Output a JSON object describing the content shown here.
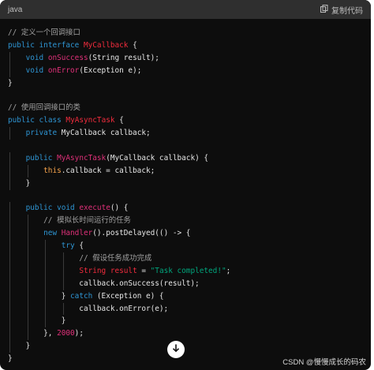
{
  "header": {
    "language": "java",
    "copy_label": "复制代码"
  },
  "code_lines": [
    [
      {
        "t": "cm",
        "v": "// 定义一个回调接口"
      }
    ],
    [
      {
        "t": "kw",
        "v": "public"
      },
      {
        "t": "pl",
        "v": " "
      },
      {
        "t": "kw",
        "v": "interface"
      },
      {
        "t": "pl",
        "v": " "
      },
      {
        "t": "cls",
        "v": "MyCallback"
      },
      {
        "t": "pl",
        "v": " {"
      }
    ],
    [
      {
        "t": "pl",
        "v": "    "
      },
      {
        "t": "kw",
        "v": "void"
      },
      {
        "t": "pl",
        "v": " "
      },
      {
        "t": "fn",
        "v": "onSuccess"
      },
      {
        "t": "pl",
        "v": "(String result);"
      }
    ],
    [
      {
        "t": "pl",
        "v": "    "
      },
      {
        "t": "kw",
        "v": "void"
      },
      {
        "t": "pl",
        "v": " "
      },
      {
        "t": "fn",
        "v": "onError"
      },
      {
        "t": "pl",
        "v": "(Exception e);"
      }
    ],
    [
      {
        "t": "pl",
        "v": "}"
      }
    ],
    [],
    [
      {
        "t": "cm",
        "v": "// 使用回调接口的类"
      }
    ],
    [
      {
        "t": "kw",
        "v": "public"
      },
      {
        "t": "pl",
        "v": " "
      },
      {
        "t": "kw",
        "v": "class"
      },
      {
        "t": "pl",
        "v": " "
      },
      {
        "t": "cls",
        "v": "MyAsyncTask"
      },
      {
        "t": "pl",
        "v": " {"
      }
    ],
    [
      {
        "t": "pl",
        "v": "    "
      },
      {
        "t": "kw",
        "v": "private"
      },
      {
        "t": "pl",
        "v": " MyCallback callback;"
      }
    ],
    [],
    [
      {
        "t": "pl",
        "v": "    "
      },
      {
        "t": "kw",
        "v": "public"
      },
      {
        "t": "pl",
        "v": " "
      },
      {
        "t": "fn",
        "v": "MyAsyncTask"
      },
      {
        "t": "pl",
        "v": "(MyCallback callback) {"
      }
    ],
    [
      {
        "t": "pl",
        "v": "        "
      },
      {
        "t": "this",
        "v": "this"
      },
      {
        "t": "pl",
        "v": ".callback = callback;"
      }
    ],
    [
      {
        "t": "pl",
        "v": "    }"
      }
    ],
    [],
    [
      {
        "t": "pl",
        "v": "    "
      },
      {
        "t": "kw",
        "v": "public"
      },
      {
        "t": "pl",
        "v": " "
      },
      {
        "t": "kw",
        "v": "void"
      },
      {
        "t": "pl",
        "v": " "
      },
      {
        "t": "fn",
        "v": "execute"
      },
      {
        "t": "pl",
        "v": "() {"
      }
    ],
    [
      {
        "t": "pl",
        "v": "        "
      },
      {
        "t": "cm",
        "v": "// 模拟长时间运行的任务"
      }
    ],
    [
      {
        "t": "pl",
        "v": "        "
      },
      {
        "t": "kw",
        "v": "new"
      },
      {
        "t": "pl",
        "v": " "
      },
      {
        "t": "fn",
        "v": "Handler"
      },
      {
        "t": "pl",
        "v": "().postDelayed(() -> {"
      }
    ],
    [
      {
        "t": "pl",
        "v": "            "
      },
      {
        "t": "kw",
        "v": "try"
      },
      {
        "t": "pl",
        "v": " {"
      }
    ],
    [
      {
        "t": "pl",
        "v": "                "
      },
      {
        "t": "cm",
        "v": "// 假设任务成功完成"
      }
    ],
    [
      {
        "t": "pl",
        "v": "                "
      },
      {
        "t": "cls",
        "v": "String"
      },
      {
        "t": "pl",
        "v": " "
      },
      {
        "t": "cls",
        "v": "result"
      },
      {
        "t": "pl",
        "v": " = "
      },
      {
        "t": "str",
        "v": "\"Task completed!\""
      },
      {
        "t": "pl",
        "v": ";"
      }
    ],
    [
      {
        "t": "pl",
        "v": "                callback.onSuccess(result);"
      }
    ],
    [
      {
        "t": "pl",
        "v": "            } "
      },
      {
        "t": "kw",
        "v": "catch"
      },
      {
        "t": "pl",
        "v": " (Exception e) {"
      }
    ],
    [
      {
        "t": "pl",
        "v": "                callback.onError(e);"
      }
    ],
    [
      {
        "t": "pl",
        "v": "            }"
      }
    ],
    [
      {
        "t": "pl",
        "v": "        }, "
      },
      {
        "t": "num",
        "v": "2000"
      },
      {
        "t": "pl",
        "v": ");"
      }
    ],
    [
      {
        "t": "pl",
        "v": "    }"
      }
    ],
    [
      {
        "t": "pl",
        "v": "}"
      }
    ]
  ],
  "scroll_button_icon": "arrow-down-icon",
  "watermark": "CSDN @慢慢成长的码农",
  "colors": {
    "background": "#0d0d0d",
    "header_bg": "#2f2f2f",
    "keyword": "#2e95d3",
    "class_name": "#f22c3d",
    "function": "#df3079",
    "comment": "#a0a0a0",
    "string": "#00a67d",
    "this_keyword": "#f7a44c"
  }
}
